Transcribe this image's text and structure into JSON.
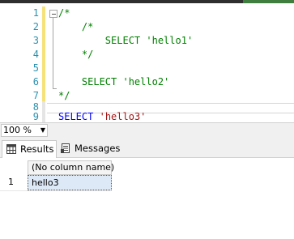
{
  "editor": {
    "lines": [
      {
        "num": "1",
        "text": "/*",
        "kind": "comment"
      },
      {
        "num": "2",
        "text": "    /*",
        "kind": "comment"
      },
      {
        "num": "3",
        "text": "        SELECT 'hello1'",
        "kind": "comment"
      },
      {
        "num": "4",
        "text": "    */",
        "kind": "comment"
      },
      {
        "num": "5",
        "text": "",
        "kind": "comment"
      },
      {
        "num": "6",
        "text": "    SELECT 'hello2'",
        "kind": "comment"
      },
      {
        "num": "7",
        "text": "*/",
        "kind": "comment"
      },
      {
        "num": "8",
        "text": "",
        "kind": "plain"
      },
      {
        "num": "9",
        "keyword": "SELECT",
        "string": "'hello3'",
        "kind": "code"
      }
    ],
    "colors": {
      "comment": "#008000",
      "keyword": "#0000ff",
      "string": "#a31515",
      "line_number": "#2b91af"
    }
  },
  "zoom": {
    "value": "100 %"
  },
  "result_tabs": [
    {
      "label": "Results",
      "icon": "grid-icon",
      "active": true
    },
    {
      "label": "Messages",
      "icon": "messages-icon",
      "active": false
    }
  ],
  "results_grid": {
    "columns": [
      "(No column name)"
    ],
    "rows": [
      {
        "row_number": "1",
        "values": [
          "hello3"
        ]
      }
    ]
  }
}
